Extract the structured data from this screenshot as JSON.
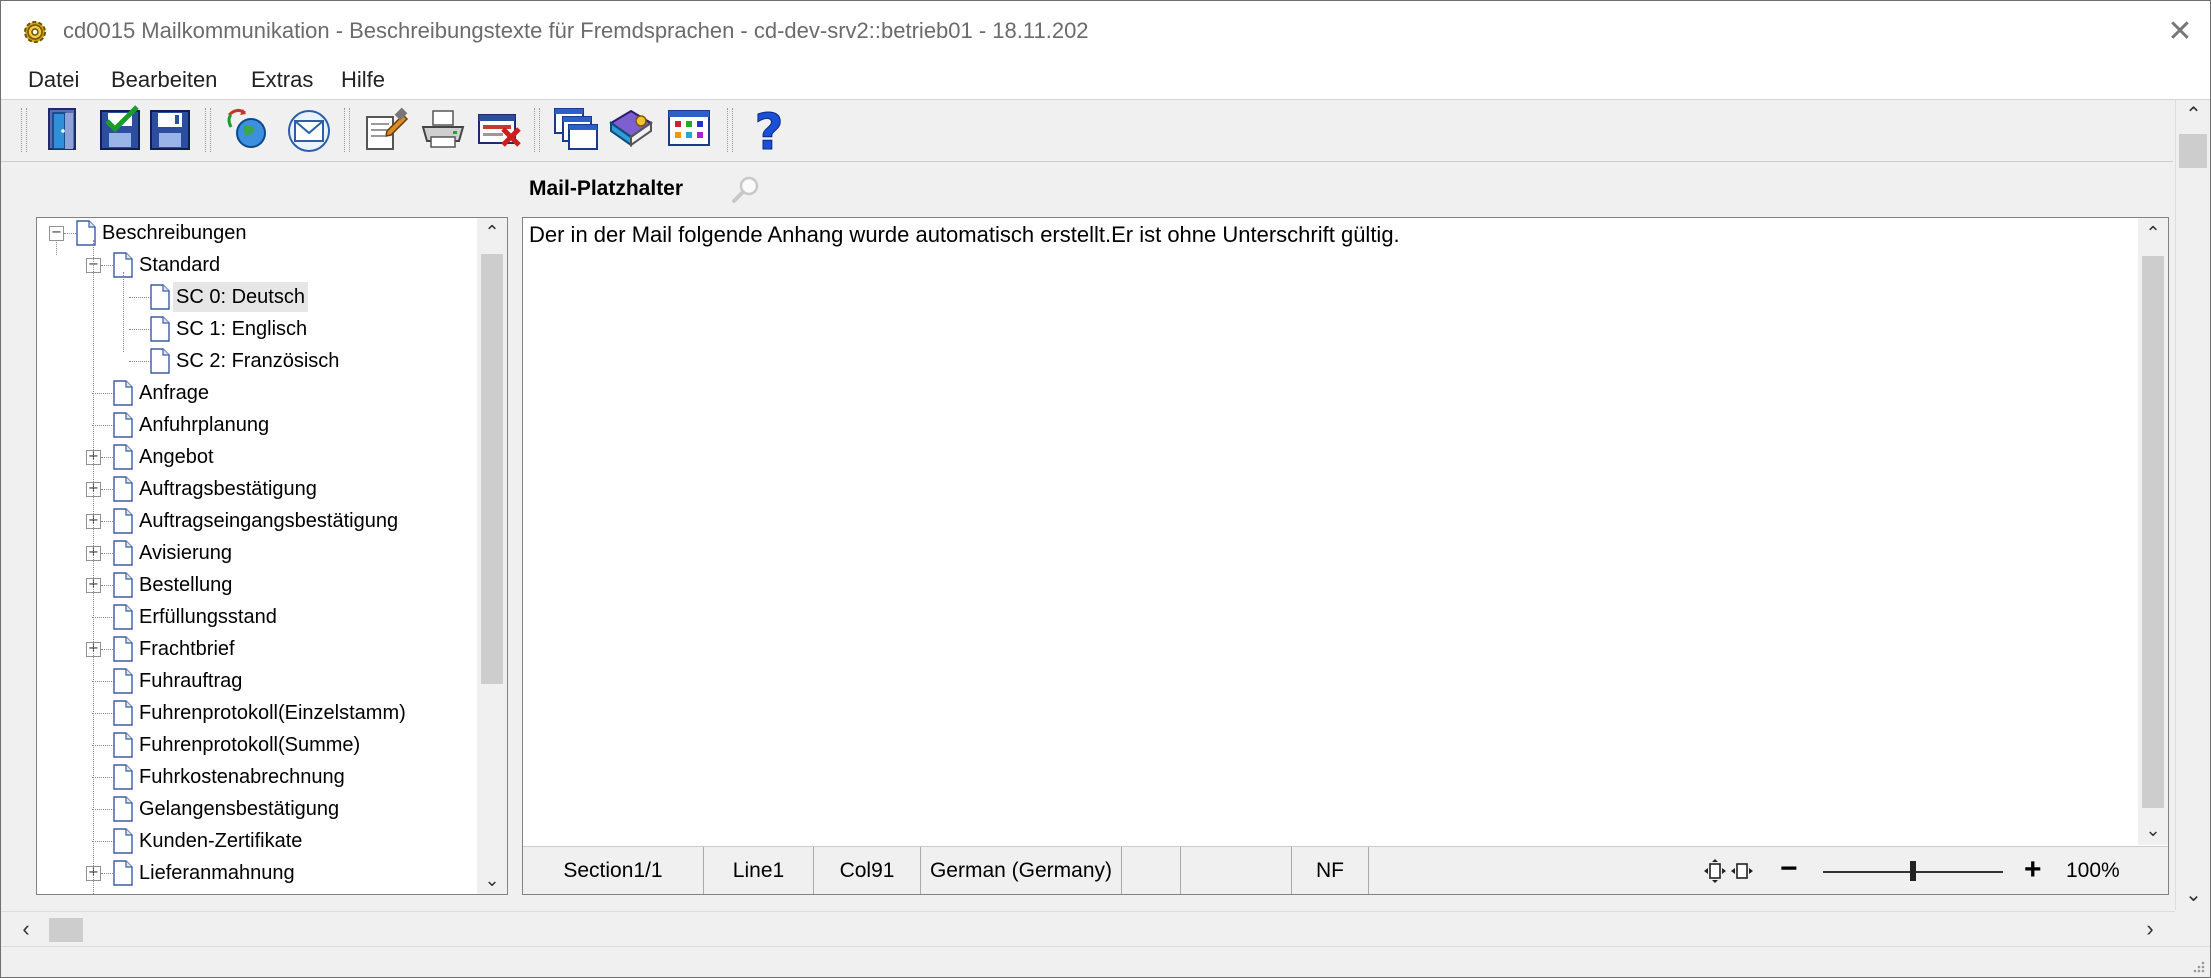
{
  "window": {
    "title": "cd0015 Mailkommunikation - Beschreibungstexte für Fremdsprachen - cd-dev-srv2::betrieb01 - 18.11.202",
    "close_glyph": "✕"
  },
  "menu": [
    "Datei",
    "Bearbeiten",
    "Extras",
    "Hilfe"
  ],
  "toolbar": {
    "buttons": [
      {
        "icon": "exit-door-icon"
      },
      {
        "icon": "save-check-icon"
      },
      {
        "icon": "save-icon"
      },
      {
        "icon": "globe-refresh-icon"
      },
      {
        "icon": "mail-envelope-icon"
      },
      {
        "icon": "edit-clipboard-icon"
      },
      {
        "icon": "printer-icon"
      },
      {
        "icon": "delete-record-icon"
      },
      {
        "icon": "windows-cascade-icon"
      },
      {
        "icon": "book-icon"
      },
      {
        "icon": "table-grid-icon"
      },
      {
        "icon": "help-icon"
      }
    ]
  },
  "editor": {
    "title": "Mail-Platzhalter",
    "content": "Der in der Mail folgende Anhang wurde automatisch erstellt.Er ist ohne Unterschrift gültig.",
    "status": {
      "section": "Section1/1",
      "line": "Line1",
      "col": "Col91",
      "language": "German (Germany)",
      "empty1": "",
      "empty2": "",
      "mode": "NF",
      "zoom_minus": "−",
      "zoom_plus": "+",
      "zoom": "100%",
      "zoom_level": 0.5
    }
  },
  "tree": {
    "nodes": [
      {
        "label": "Beschreibungen",
        "level": 0,
        "expander": "−"
      },
      {
        "label": "Standard",
        "level": 1,
        "expander": "−"
      },
      {
        "label": "SC 0: Deutsch",
        "level": 2,
        "expander": "",
        "selected": true
      },
      {
        "label": "SC 1: Englisch",
        "level": 2,
        "expander": ""
      },
      {
        "label": "SC 2: Französisch",
        "level": 2,
        "expander": ""
      },
      {
        "label": "Anfrage",
        "level": 1,
        "expander": ""
      },
      {
        "label": "Anfuhrplanung",
        "level": 1,
        "expander": ""
      },
      {
        "label": "Angebot",
        "level": 1,
        "expander": "+"
      },
      {
        "label": "Auftragsbestätigung",
        "level": 1,
        "expander": "+"
      },
      {
        "label": "Auftragseingangsbestätigung",
        "level": 1,
        "expander": "+"
      },
      {
        "label": "Avisierung",
        "level": 1,
        "expander": "+"
      },
      {
        "label": "Bestellung",
        "level": 1,
        "expander": "+"
      },
      {
        "label": "Erfüllungsstand",
        "level": 1,
        "expander": ""
      },
      {
        "label": "Frachtbrief",
        "level": 1,
        "expander": "+"
      },
      {
        "label": "Fuhrauftrag",
        "level": 1,
        "expander": ""
      },
      {
        "label": "Fuhrenprotokoll(Einzelstamm)",
        "level": 1,
        "expander": ""
      },
      {
        "label": "Fuhrenprotokoll(Summe)",
        "level": 1,
        "expander": ""
      },
      {
        "label": "Fuhrkostenabrechnung",
        "level": 1,
        "expander": ""
      },
      {
        "label": "Gelangensbestätigung",
        "level": 1,
        "expander": ""
      },
      {
        "label": "Kunden-Zertifikate",
        "level": 1,
        "expander": ""
      },
      {
        "label": "Lieferanmahnung",
        "level": 1,
        "expander": "+"
      }
    ]
  }
}
